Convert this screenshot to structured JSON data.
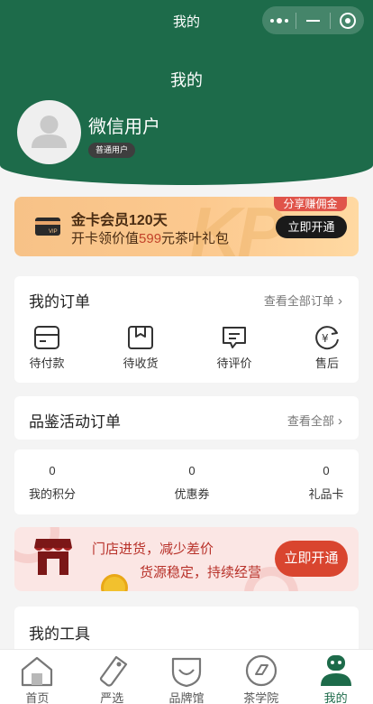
{
  "nav": {
    "title": "我的",
    "menu_icon": "more-dots-icon",
    "minimize_icon": "minimize-icon",
    "close_icon": "target-close-icon"
  },
  "profile": {
    "page_title": "我的",
    "username": "微信用户",
    "level": "普通用户"
  },
  "gold_card": {
    "title": "金卡会员120天",
    "subtitle_prefix": "开卡领价值",
    "subtitle_value": "599",
    "subtitle_suffix": "元茶叶礼包",
    "share_label": "分享赚佣金",
    "open_label": "立即开通",
    "watermark": "KP",
    "colors": {
      "bg": "#fcc98f",
      "highlight": "#c2432a"
    }
  },
  "orders": {
    "title": "我的订单",
    "view_all": "查看全部订单",
    "items": [
      {
        "label": "待付款",
        "icon": "wallet-card-icon"
      },
      {
        "label": "待收货",
        "icon": "package-box-icon"
      },
      {
        "label": "待评价",
        "icon": "comment-bubble-icon"
      },
      {
        "label": "售后",
        "icon": "yuan-refund-icon"
      }
    ]
  },
  "tasting": {
    "title": "品鉴活动订单",
    "view_all": "查看全部"
  },
  "assets": [
    {
      "value": "0",
      "label": "我的积分"
    },
    {
      "value": "0",
      "label": "优惠券"
    },
    {
      "value": "0",
      "label": "礼品卡"
    }
  ],
  "store_banner": {
    "line1": "门店进货，减少差价",
    "line2": "货源稳定，持续经营",
    "button": "立即开通",
    "colors": {
      "bg": "#fbe6e4",
      "text": "#b8322a",
      "button": "#d9452f"
    }
  },
  "tools": {
    "title": "我的工具"
  },
  "tabbar": [
    {
      "label": "首页",
      "icon": "home-icon",
      "active": false
    },
    {
      "label": "严选",
      "icon": "tag-icon",
      "active": false
    },
    {
      "label": "品牌馆",
      "icon": "brand-shield-icon",
      "active": false
    },
    {
      "label": "茶学院",
      "icon": "academy-circle-icon",
      "active": false
    },
    {
      "label": "我的",
      "icon": "profile-icon",
      "active": true
    }
  ],
  "theme": {
    "primary": "#1d6b4a"
  }
}
